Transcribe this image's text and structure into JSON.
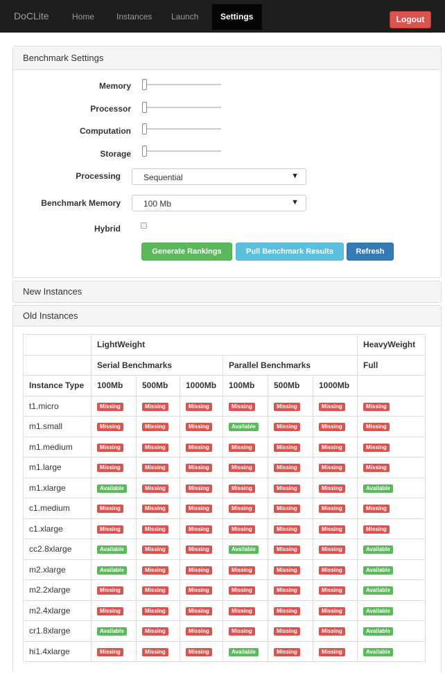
{
  "nav": {
    "brand": "DoCLite",
    "links": [
      "Home",
      "Instances",
      "Launch",
      "Settings"
    ],
    "logout": "Logout"
  },
  "benchmark": {
    "heading": "Benchmark Settings",
    "memory_label": "Memory",
    "processor_label": "Processor",
    "computation_label": "Computation",
    "storage_label": "Storage",
    "processing_label": "Processing",
    "processing_value": "Sequential",
    "bench_memory_label": "Benchmark Memory",
    "bench_memory_value": "100 Mb",
    "hybrid_label": "Hybrid",
    "hybrid_checked": false,
    "buttons": {
      "generate": "Generate Rankings",
      "pull": "Pull Benchmark Results",
      "refresh": "Refresh"
    }
  },
  "new_instances": {
    "heading": "New Instances"
  },
  "old_instances": {
    "heading": "Old Instances",
    "group_light": "LightWeight",
    "group_heavy": "HeavyWeight",
    "serial": "Serial Benchmarks",
    "parallel": "Parallel Benchmarks",
    "full": "Full",
    "instance_type": "Instance Type",
    "col_100": "100Mb",
    "col_500": "500Mb",
    "col_1000": "1000Mb",
    "status_labels": {
      "M": "Missing",
      "A": "Available"
    },
    "rows": [
      {
        "name": "t1.micro",
        "status": [
          "M",
          "M",
          "M",
          "M",
          "M",
          "M",
          "M"
        ]
      },
      {
        "name": "m1.small",
        "status": [
          "M",
          "M",
          "M",
          "A",
          "M",
          "M",
          "M"
        ]
      },
      {
        "name": "m1.medium",
        "status": [
          "M",
          "M",
          "M",
          "M",
          "M",
          "M",
          "M"
        ]
      },
      {
        "name": "m1.large",
        "status": [
          "M",
          "M",
          "M",
          "M",
          "M",
          "M",
          "M"
        ]
      },
      {
        "name": "m1.xlarge",
        "status": [
          "A",
          "M",
          "M",
          "M",
          "M",
          "M",
          "A"
        ]
      },
      {
        "name": "c1.medium",
        "status": [
          "M",
          "M",
          "M",
          "M",
          "M",
          "M",
          "M"
        ]
      },
      {
        "name": "c1.xlarge",
        "status": [
          "M",
          "M",
          "M",
          "M",
          "M",
          "M",
          "M"
        ]
      },
      {
        "name": "cc2.8xlarge",
        "status": [
          "A",
          "M",
          "M",
          "A",
          "M",
          "M",
          "A"
        ]
      },
      {
        "name": "m2.xlarge",
        "status": [
          "A",
          "M",
          "M",
          "M",
          "M",
          "M",
          "A"
        ]
      },
      {
        "name": "m2.2xlarge",
        "status": [
          "M",
          "M",
          "M",
          "M",
          "M",
          "M",
          "A"
        ]
      },
      {
        "name": "m2.4xlarge",
        "status": [
          "M",
          "M",
          "M",
          "M",
          "M",
          "M",
          "A"
        ]
      },
      {
        "name": "cr1.8xlarge",
        "status": [
          "A",
          "M",
          "M",
          "M",
          "M",
          "M",
          "A"
        ]
      },
      {
        "name": "hi1.4xlarge",
        "status": [
          "M",
          "M",
          "M",
          "A",
          "M",
          "M",
          "A"
        ]
      }
    ]
  }
}
